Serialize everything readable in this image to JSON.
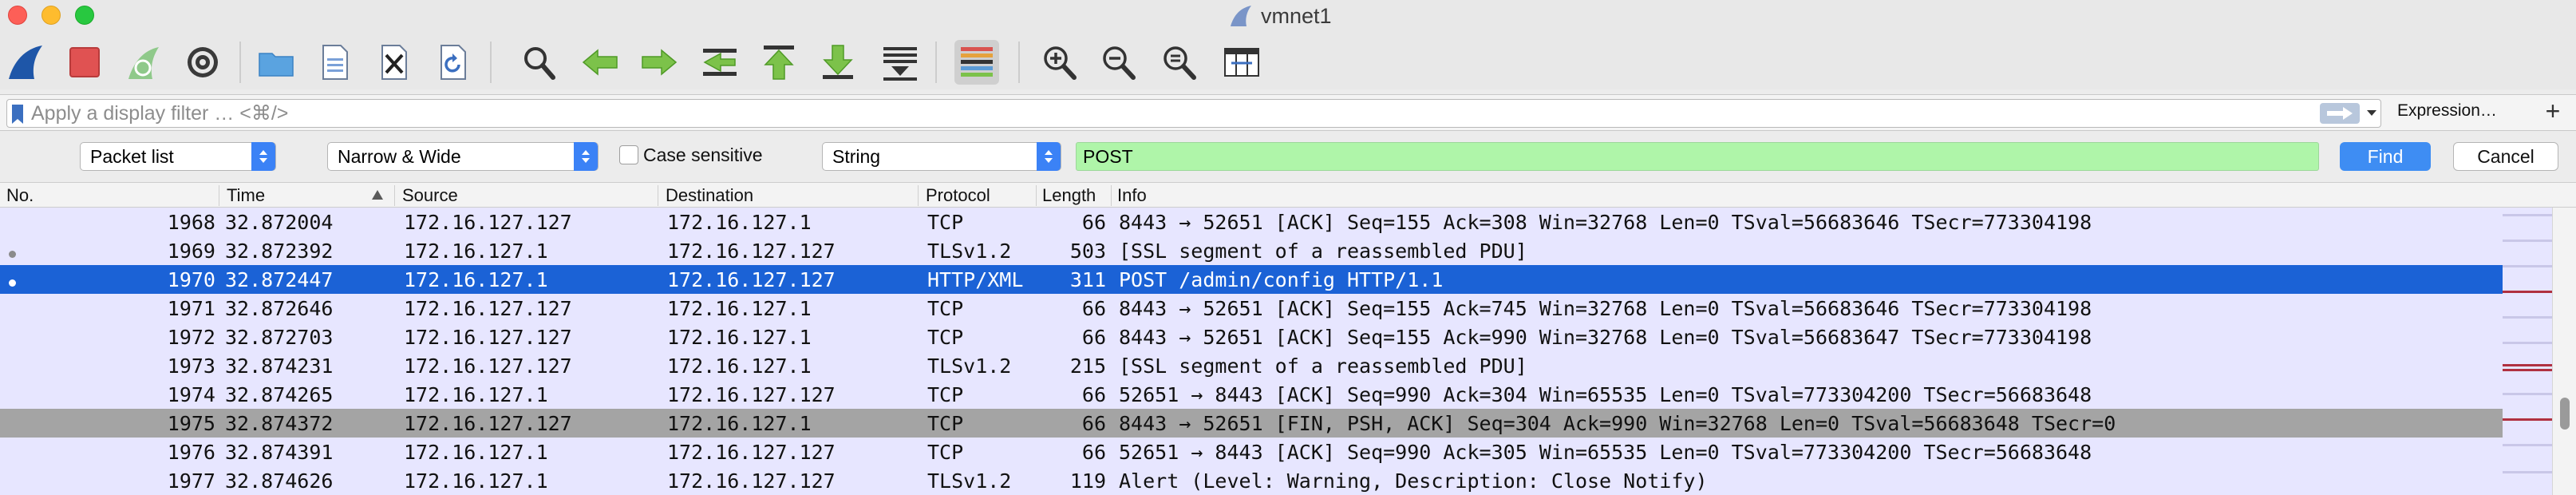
{
  "window": {
    "title": "vmnet1"
  },
  "toolbar": {
    "icons": [
      "shark-fin-icon",
      "stop-icon",
      "restart-icon",
      "gear-icon",
      "folder-icon",
      "save-file-icon",
      "close-file-icon",
      "reload-icon",
      "search-icon",
      "back-arrow-icon",
      "forward-arrow-icon",
      "go-to-packet-icon",
      "first-packet-icon",
      "last-packet-icon",
      "autoscroll-icon",
      "colorize-icon",
      "zoom-in-icon",
      "zoom-out-icon",
      "zoom-reset-icon",
      "resize-columns-icon"
    ]
  },
  "filter": {
    "placeholder": "Apply a display filter … <⌘/>",
    "value": "",
    "expression_label": "Expression…",
    "plus_label": "+"
  },
  "findbar": {
    "search_in": "Packet list",
    "char_width": "Narrow & Wide",
    "case_sensitive_label": "Case sensitive",
    "case_sensitive": false,
    "search_type": "String",
    "search_value": "POST",
    "find_label": "Find",
    "cancel_label": "Cancel"
  },
  "columns": {
    "no": "No.",
    "time": "Time",
    "source": "Source",
    "destination": "Destination",
    "protocol": "Protocol",
    "length": "Length",
    "info": "Info"
  },
  "packets": [
    {
      "no": "1968",
      "time": "32.872004",
      "source": "172.16.127.127",
      "destination": "172.16.127.1",
      "protocol": "TCP",
      "length": "66",
      "info": "8443 → 52651 [ACK] Seq=155 Ack=308 Win=32768 Len=0 TSval=56683646 TSecr=773304198"
    },
    {
      "no": "1969",
      "time": "32.872392",
      "source": "172.16.127.1",
      "destination": "172.16.127.127",
      "protocol": "TLSv1.2",
      "length": "503",
      "info": "[SSL segment of a reassembled PDU]"
    },
    {
      "no": "1970",
      "time": "32.872447",
      "source": "172.16.127.1",
      "destination": "172.16.127.127",
      "protocol": "HTTP/XML",
      "length": "311",
      "info": "POST /admin/config HTTP/1.1"
    },
    {
      "no": "1971",
      "time": "32.872646",
      "source": "172.16.127.127",
      "destination": "172.16.127.1",
      "protocol": "TCP",
      "length": "66",
      "info": "8443 → 52651 [ACK] Seq=155 Ack=745 Win=32768 Len=0 TSval=56683646 TSecr=773304198"
    },
    {
      "no": "1972",
      "time": "32.872703",
      "source": "172.16.127.127",
      "destination": "172.16.127.1",
      "protocol": "TCP",
      "length": "66",
      "info": "8443 → 52651 [ACK] Seq=155 Ack=990 Win=32768 Len=0 TSval=56683647 TSecr=773304198"
    },
    {
      "no": "1973",
      "time": "32.874231",
      "source": "172.16.127.127",
      "destination": "172.16.127.1",
      "protocol": "TLSv1.2",
      "length": "215",
      "info": "[SSL segment of a reassembled PDU]"
    },
    {
      "no": "1974",
      "time": "32.874265",
      "source": "172.16.127.1",
      "destination": "172.16.127.127",
      "protocol": "TCP",
      "length": "66",
      "info": "52651 → 8443 [ACK] Seq=990 Ack=304 Win=65535 Len=0 TSval=773304200 TSecr=56683648"
    },
    {
      "no": "1975",
      "time": "32.874372",
      "source": "172.16.127.127",
      "destination": "172.16.127.1",
      "protocol": "TCP",
      "length": "66",
      "info": "8443 → 52651 [FIN, PSH, ACK] Seq=304 Ack=990 Win=32768 Len=0 TSval=56683648 TSecr=0"
    },
    {
      "no": "1976",
      "time": "32.874391",
      "source": "172.16.127.1",
      "destination": "172.16.127.127",
      "protocol": "TCP",
      "length": "66",
      "info": "52651 → 8443 [ACK] Seq=990 Ack=305 Win=65535 Len=0 TSval=773304200 TSecr=56683648"
    },
    {
      "no": "1977",
      "time": "32.874626",
      "source": "172.16.127.1",
      "destination": "172.16.127.127",
      "protocol": "TLSv1.2",
      "length": "119",
      "info": "Alert (Level: Warning, Description: Close Notify)"
    }
  ],
  "colors": {
    "row_default": "#e7e6ff",
    "row_selected": "#1b62d6",
    "row_fin": "#a4a4a4",
    "find_match": "#aff5a9",
    "accent": "#3e8df3"
  }
}
